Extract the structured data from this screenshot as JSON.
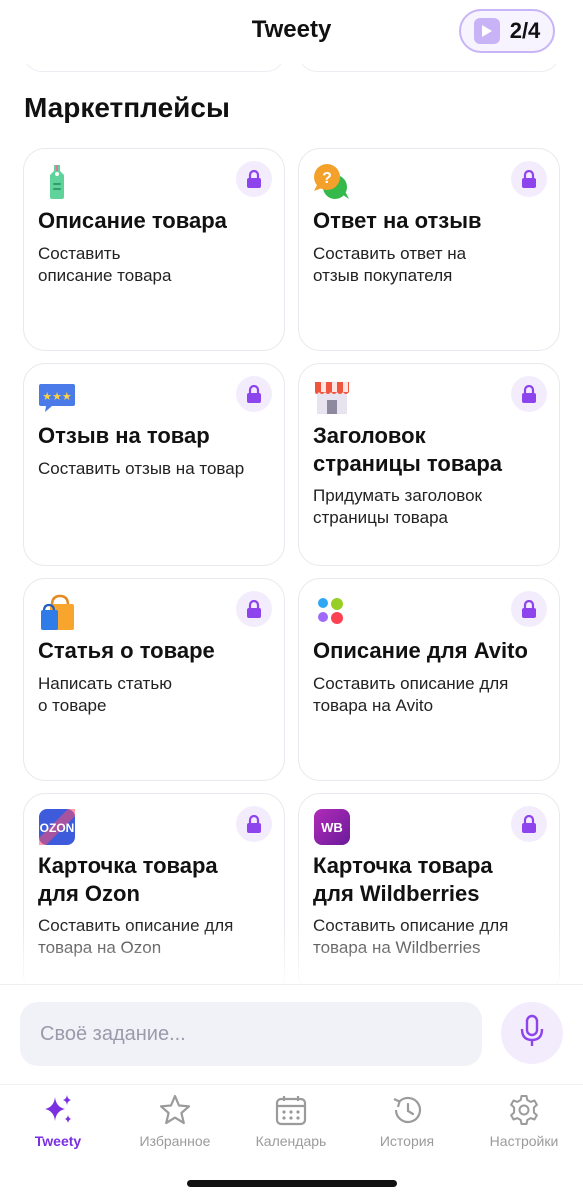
{
  "header": {
    "title": "Tweety",
    "counter": "2/4"
  },
  "section": {
    "title": "Маркетплейсы"
  },
  "cards": [
    {
      "icon": "price-tag-icon",
      "title": "Описание товара",
      "description": "Составить\nописание товара",
      "locked": true
    },
    {
      "icon": "question-chat-icon",
      "title": "Ответ на отзыв",
      "description": "Составить ответ на\nотзыв покупателя",
      "locked": true
    },
    {
      "icon": "stars-review-icon",
      "title": "Отзыв на товар",
      "description": "Составить отзыв на товар",
      "locked": true
    },
    {
      "icon": "storefront-icon",
      "title": "Заголовок\nстраницы товара",
      "description": "Придумать заголовок\nстраницы товара",
      "locked": true
    },
    {
      "icon": "shopping-bags-icon",
      "title": "Статья о товаре",
      "description": "Написать статью\nо товаре",
      "locked": true
    },
    {
      "icon": "avito-icon",
      "title": "Описание для Avito",
      "description": "Составить описание для\nтовара на Avito",
      "locked": true
    },
    {
      "icon": "ozon-logo-icon",
      "title": "Карточка товара\nдля Ozon",
      "description": "Составить описание для\nтовара на Ozon",
      "locked": true
    },
    {
      "icon": "wildberries-logo-icon",
      "title": "Карточка товара\nдля Wildberries",
      "description": "Составить описание для\nтовара на Wildberries",
      "locked": true
    }
  ],
  "logos": {
    "ozon": "OZON",
    "wb": "WB"
  },
  "input": {
    "placeholder": "Своё задание..."
  },
  "tabs": [
    {
      "label": "Tweety",
      "icon": "sparkles-icon",
      "active": true
    },
    {
      "label": "Избранное",
      "icon": "star-icon",
      "active": false
    },
    {
      "label": "Календарь",
      "icon": "calendar-icon",
      "active": false
    },
    {
      "label": "История",
      "icon": "history-icon",
      "active": false
    },
    {
      "label": "Настройки",
      "icon": "gear-icon",
      "active": false
    }
  ],
  "colors": {
    "accent": "#7a2fe0",
    "lock_bg": "#f3ecfd",
    "lock_icon": "#8e44ec",
    "inactive": "#9b9b9b"
  }
}
